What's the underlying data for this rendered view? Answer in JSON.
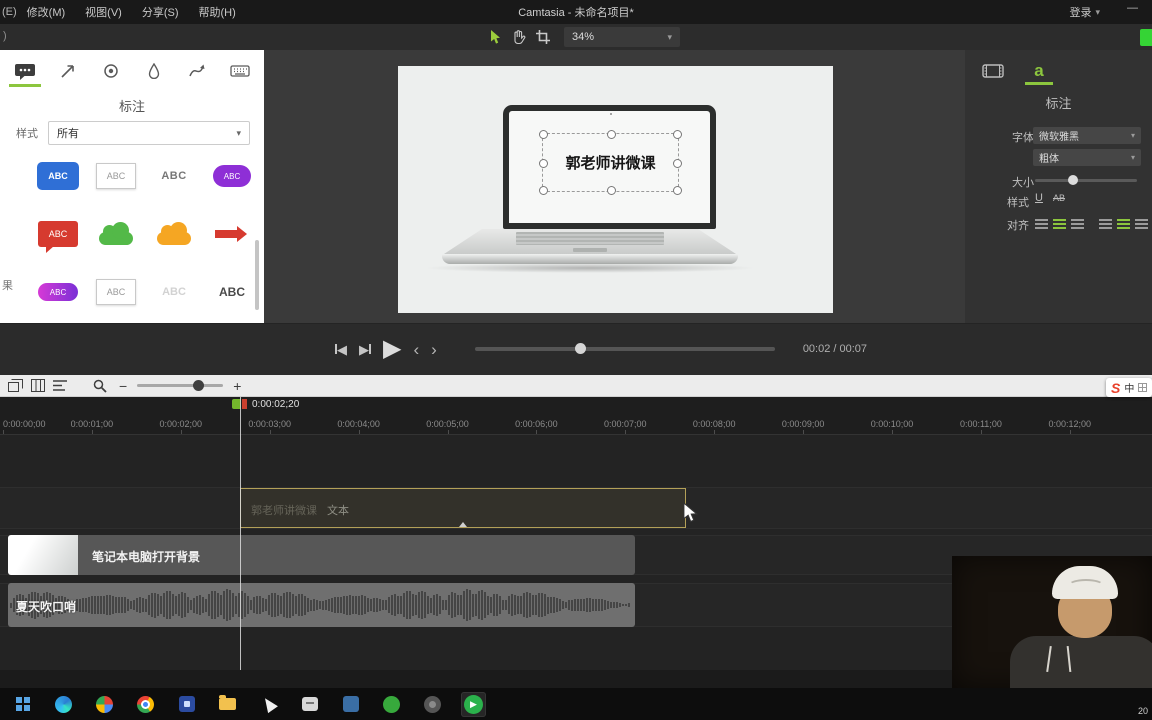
{
  "icons": {
    "caret_down": "▾",
    "minus": "−",
    "plus": "+",
    "play": "▶",
    "prev": "◀",
    "next": "▶",
    "back": "‹",
    "forward": "›"
  },
  "menubar": {
    "partial_menu": "(E)",
    "menus": [
      "修改(M)",
      "视图(V)",
      "分享(S)",
      "帮助(H)"
    ],
    "title": "Camtasia - 未命名项目*",
    "login_label": "登录",
    "minimize_glyph": "—"
  },
  "toolbar": {
    "partial_label": ")",
    "zoom_value": "34%"
  },
  "left_panel": {
    "title": "标注",
    "style_label": "样式",
    "style_value": "所有",
    "side_partial": "果",
    "thumbs": [
      {
        "kind": "pill-blue",
        "text": "ABC"
      },
      {
        "kind": "box-white",
        "text": "ABC"
      },
      {
        "kind": "plain",
        "text": "ABC"
      },
      {
        "kind": "pill-purple",
        "text": "ABC"
      },
      {
        "kind": "banner-red",
        "text": "ABC"
      },
      {
        "kind": "cloud-green",
        "text": ""
      },
      {
        "kind": "cloud-orange",
        "text": ""
      },
      {
        "kind": "arrow-red",
        "text": ""
      },
      {
        "kind": "pill-magenta",
        "text": "ABC"
      },
      {
        "kind": "box-white2",
        "text": "ABC"
      },
      {
        "kind": "text-faint",
        "text": "ABC"
      },
      {
        "kind": "text-dark",
        "text": "ABC"
      }
    ]
  },
  "canvas": {
    "selected_text": "郭老师讲微课"
  },
  "right_panel": {
    "title": "标注",
    "tab_text_glyph": "a",
    "font_label": "字体",
    "font_value": "微软雅黑",
    "weight_value": "粗体",
    "size_label": "大小",
    "style_label": "样式",
    "underline_glyph": "U",
    "strike_glyph": "AB",
    "align_label": "对齐"
  },
  "playback": {
    "time_display": "00:02 / 00:07"
  },
  "timeline": {
    "playhead_label": "0:00:02;20",
    "ruler_labels": [
      "0:00:00;00",
      "0:00:01;00",
      "0:00:02;00",
      "0:00:03;00",
      "0:00:04;00",
      "0:00:05;00",
      "0:00:06;00",
      "0:00:07;00",
      "0:00:08;00",
      "0:00:09;00",
      "0:00:10;00",
      "0:00:11;00",
      "0:00:12;00"
    ],
    "text_clip": {
      "ghost": "郭老师讲微课",
      "label": "文本"
    },
    "video_clip": {
      "label": "笔记本电脑打开背景"
    },
    "audio_clip": {
      "label": "夏天吹口哨"
    }
  },
  "ime": {
    "sogou_letter": "S",
    "mode": "中"
  },
  "taskbar": {
    "clock": "20"
  }
}
